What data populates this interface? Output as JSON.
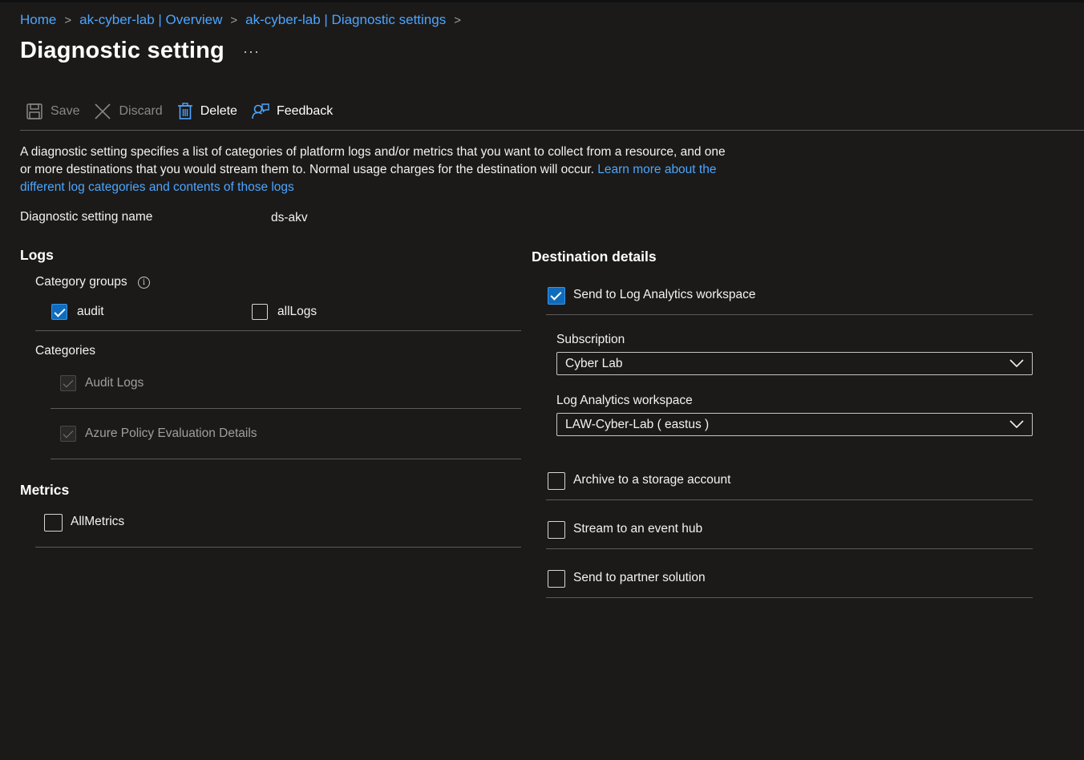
{
  "breadcrumb": {
    "items": [
      "Home",
      "ak-cyber-lab | Overview",
      "ak-cyber-lab | Diagnostic settings"
    ],
    "separator": ">"
  },
  "page": {
    "title": "Diagnostic setting",
    "more": "···"
  },
  "toolbar": {
    "save": "Save",
    "discard": "Discard",
    "delete": "Delete",
    "feedback": "Feedback"
  },
  "description": {
    "text": "A diagnostic setting specifies a list of categories of platform logs and/or metrics that you want to collect from a resource, and one or more destinations that you would stream them to. Normal usage charges for the destination will occur. ",
    "link": "Learn more about the different log categories and contents of those logs"
  },
  "setting_name": {
    "label": "Diagnostic setting name",
    "value": "ds-akv"
  },
  "logs": {
    "heading": "Logs",
    "category_groups_label": "Category groups",
    "groups": [
      {
        "label": "audit",
        "checked": true
      },
      {
        "label": "allLogs",
        "checked": false
      }
    ],
    "categories_label": "Categories",
    "categories": [
      {
        "label": "Audit Logs",
        "checked": true,
        "disabled": true
      },
      {
        "label": "Azure Policy Evaluation Details",
        "checked": true,
        "disabled": true
      }
    ]
  },
  "metrics": {
    "heading": "Metrics",
    "items": [
      {
        "label": "AllMetrics",
        "checked": false
      }
    ]
  },
  "destination": {
    "heading": "Destination details",
    "log_analytics": {
      "label": "Send to Log Analytics workspace",
      "checked": true
    },
    "subscription": {
      "label": "Subscription",
      "value": "Cyber Lab"
    },
    "workspace": {
      "label": "Log Analytics workspace",
      "value": "LAW-Cyber-Lab ( eastus )"
    },
    "storage": {
      "label": "Archive to a storage account",
      "checked": false
    },
    "event_hub": {
      "label": "Stream to an event hub",
      "checked": false
    },
    "partner": {
      "label": "Send to partner solution",
      "checked": false
    }
  },
  "colors": {
    "background": "#1b1a19",
    "link": "#4ca5ff",
    "checkbox_checked": "#0f6cbd",
    "divider": "#5c5b5a"
  }
}
